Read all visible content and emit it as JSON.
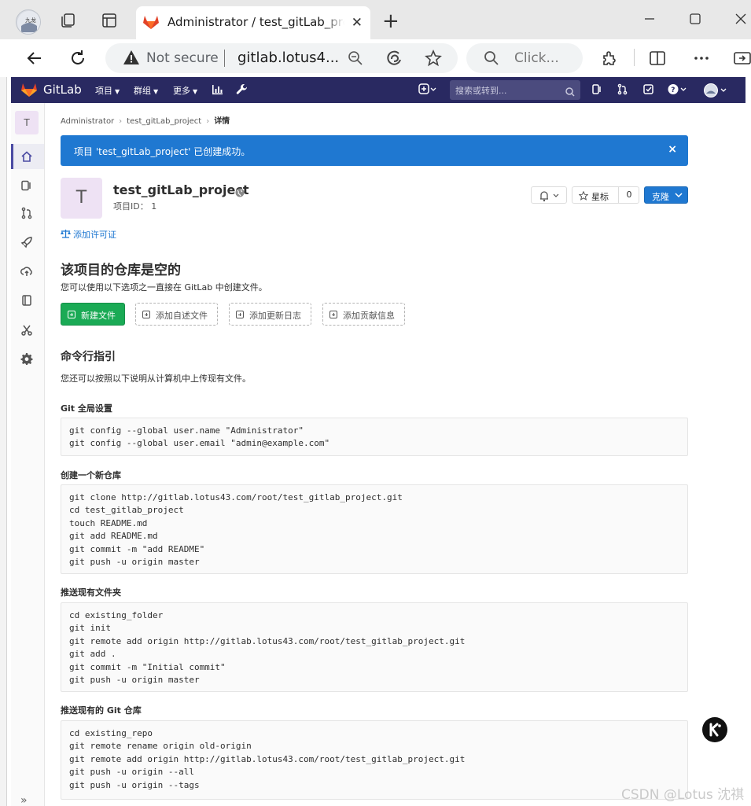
{
  "browser": {
    "tab_title": "Administrator / test_gitLab_project · GitLab",
    "security_label": "Not secure",
    "url": "gitlab.lotus4...",
    "search_placeholder": "Click..."
  },
  "gitlab": {
    "brand": "GitLab",
    "nav": {
      "projects": "项目",
      "groups": "群组",
      "more": "更多"
    },
    "search_placeholder": "搜索或转到...",
    "accent_color": "#292961"
  },
  "sidebar": {
    "project_initial": "T",
    "items": [
      "home-icon",
      "repository-icon",
      "merge-request-icon",
      "rocket-icon",
      "operations-icon",
      "wiki-icon",
      "snippets-icon",
      "settings-icon"
    ]
  },
  "breadcrumb": {
    "admin": "Administrator",
    "project": "test_gitLab_project",
    "current": "详情"
  },
  "flash": {
    "message": "项目 'test_gitLab_project' 已创建成功。",
    "close": "×",
    "color": "#1f78d1"
  },
  "project": {
    "initial": "T",
    "name": "test_gitLab_project",
    "id_label": "项目ID： 1",
    "star_label": "星标",
    "star_count": "0",
    "clone_label": "克隆",
    "add_license": "添加许可证"
  },
  "empty": {
    "title": "该项目的仓库是空的",
    "desc": "您可以使用以下选项之一直接在 GitLab 中创建文件。",
    "buttons": {
      "new_file": "新建文件",
      "readme": "添加自述文件",
      "changelog": "添加更新日志",
      "contributing": "添加贡献信息"
    }
  },
  "cli": {
    "title": "命令行指引",
    "desc": "您还可以按照以下说明从计算机中上传现有文件。",
    "sections": [
      {
        "title": "Git 全局设置",
        "lines": [
          "git config --global user.name \"Administrator\"",
          "git config --global user.email \"admin@example.com\""
        ]
      },
      {
        "title": "创建一个新仓库",
        "lines": [
          "git clone http://gitlab.lotus43.com/root/test_gitlab_project.git",
          "cd test_gitlab_project",
          "touch README.md",
          "git add README.md",
          "git commit -m \"add README\"",
          "git push -u origin master"
        ]
      },
      {
        "title": "推送现有文件夹",
        "lines": [
          "cd existing_folder",
          "git init",
          "git remote add origin http://gitlab.lotus43.com/root/test_gitlab_project.git",
          "git add .",
          "git commit -m \"Initial commit\"",
          "git push -u origin master"
        ]
      },
      {
        "title": "推送现有的 Git 仓库",
        "lines": [
          "cd existing_repo",
          "git remote rename origin old-origin",
          "git remote add origin http://gitlab.lotus43.com/root/test_gitlab_project.git",
          "git push -u origin --all",
          "git push -u origin --tags"
        ]
      }
    ]
  },
  "watermark": "CSDN @Lotus 沈祺"
}
